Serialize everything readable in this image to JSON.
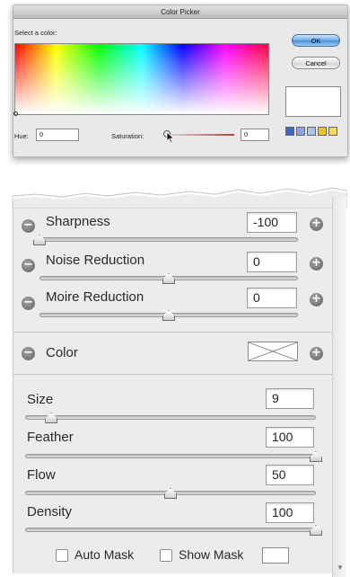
{
  "color_picker": {
    "title": "Color Picker",
    "prompt": "Select a color:",
    "hue_label": "Hue:",
    "hue_value": "0",
    "saturation_label": "Saturation:",
    "saturation_value": "0",
    "ok_label": "OK",
    "cancel_label": "Cancel",
    "selected_color": "#ffffff",
    "swatch_colors": [
      "#3f66c9",
      "#8aa6e3",
      "#a9c4ee",
      "#f3c12b",
      "#f6d85a"
    ]
  },
  "sharpen_panel": {
    "sharpness": {
      "label": "Sharpness",
      "value": "-100",
      "level": 0.0
    },
    "noise_reduction": {
      "label": "Noise Reduction",
      "value": "0",
      "level": 0.5
    },
    "moire_reduction": {
      "label": "Moire Reduction",
      "value": "0",
      "level": 0.5
    },
    "color": {
      "label": "Color"
    }
  },
  "brush_panel": {
    "size": {
      "label": "Size",
      "value": "9",
      "level": 0.09
    },
    "feather": {
      "label": "Feather",
      "value": "100",
      "level": 1.0
    },
    "flow": {
      "label": "Flow",
      "value": "50",
      "level": 0.5
    },
    "density": {
      "label": "Density",
      "value": "100",
      "level": 1.0
    },
    "auto_mask_label": "Auto Mask",
    "show_mask_label": "Show Mask"
  },
  "icons": {
    "minus": "−",
    "plus": "+"
  }
}
